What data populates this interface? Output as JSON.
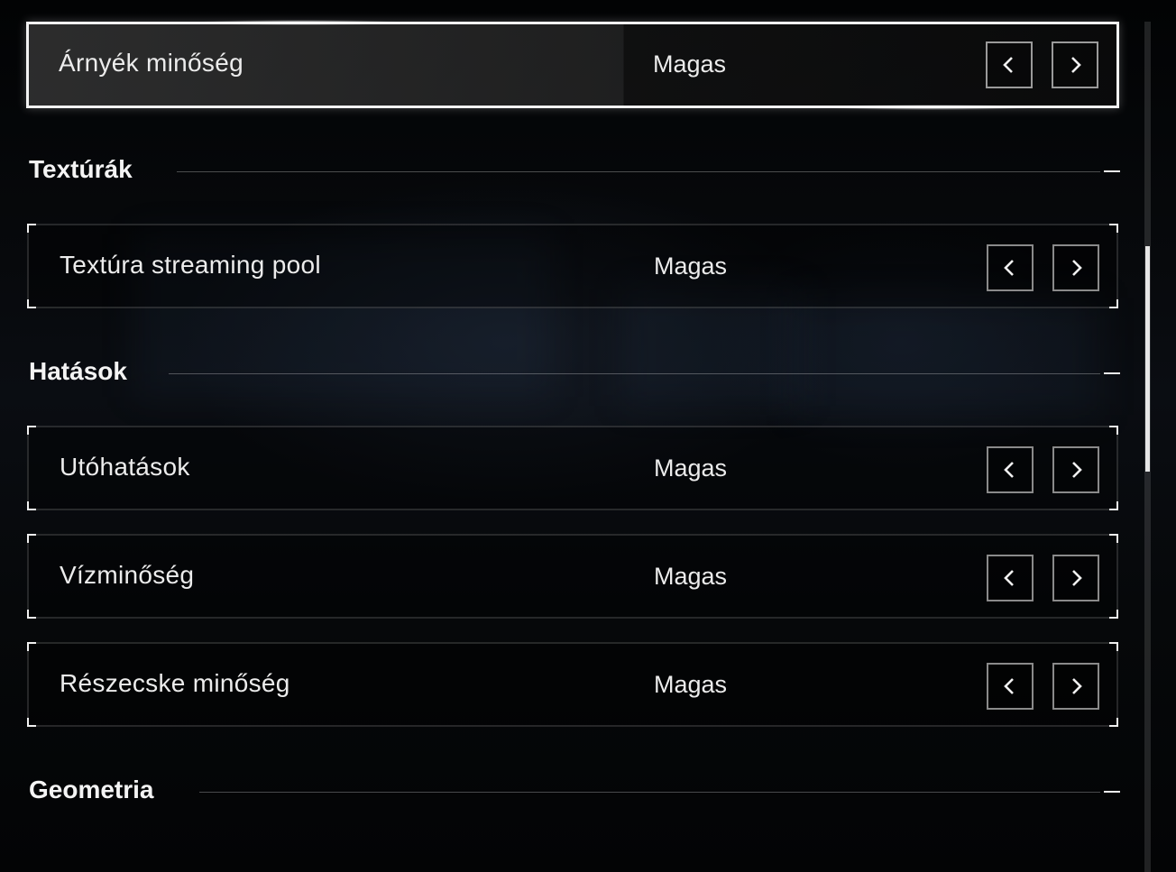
{
  "settings_list": {
    "rows": [
      {
        "label": "Árnyék minőség",
        "value": "Magas",
        "selected": true
      },
      {
        "label": "Textúra streaming pool",
        "value": "Magas",
        "selected": false
      },
      {
        "label": "Utóhatások",
        "value": "Magas",
        "selected": false
      },
      {
        "label": "Vízminőség",
        "value": "Magas",
        "selected": false
      },
      {
        "label": "Részecske minőség",
        "value": "Magas",
        "selected": false
      }
    ],
    "sections": [
      {
        "title": "Textúrák"
      },
      {
        "title": "Hatások"
      },
      {
        "title": "Geometria"
      }
    ]
  },
  "controls": {
    "prev_icon": "chevron-left-icon",
    "next_icon": "chevron-right-icon"
  },
  "colors": {
    "accent": "#f2f2f2",
    "background": "#050607",
    "button_border": "#8a8a8a"
  }
}
